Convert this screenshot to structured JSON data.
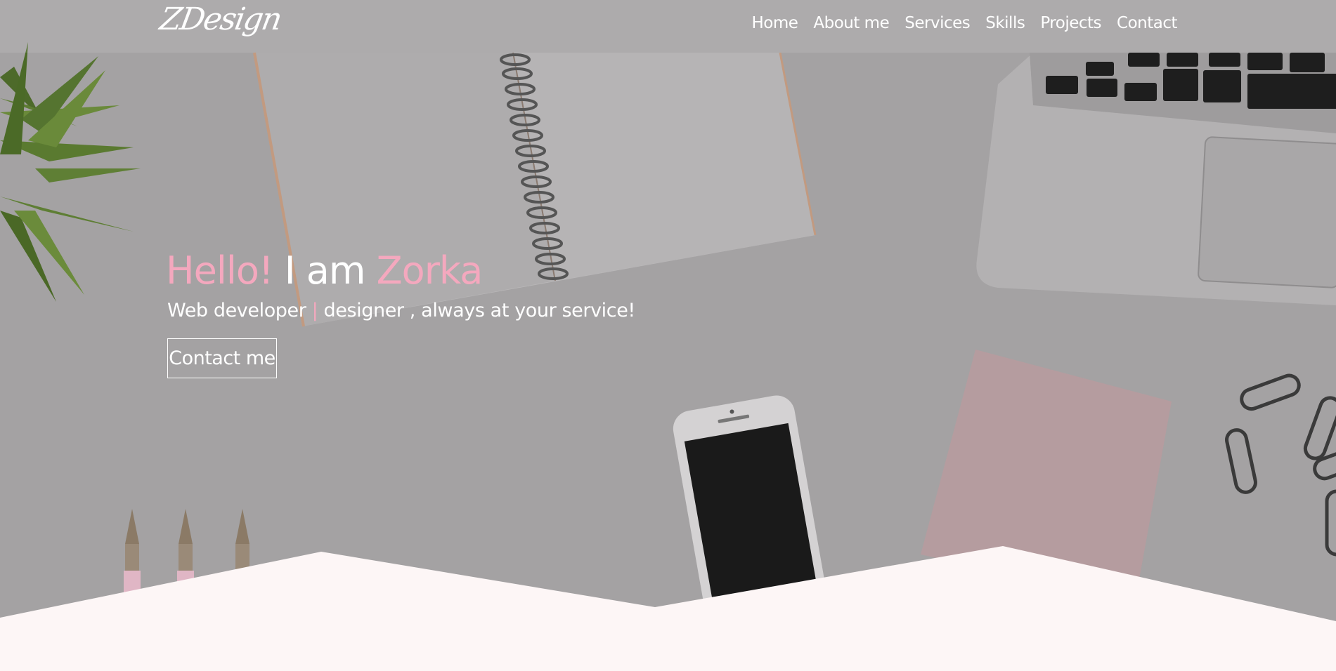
{
  "brand": {
    "logo_text": "ZDesign"
  },
  "nav": {
    "items": [
      {
        "label": "Home"
      },
      {
        "label": "About me"
      },
      {
        "label": "Services"
      },
      {
        "label": "Skills"
      },
      {
        "label": "Projects"
      },
      {
        "label": "Contact"
      }
    ]
  },
  "hero": {
    "greeting": "Hello!",
    "i_am": "I am",
    "name": "Zorka",
    "subtitle_part1": "Web developer",
    "subtitle_separator": "|",
    "subtitle_part2": "designer , always at your service!",
    "cta_label": "Contact me"
  },
  "colors": {
    "accent_pink": "#f4a8be",
    "overlay_gray": "#a4a2a3",
    "text_white": "#ffffff",
    "section_bg": "#fdf6f6"
  }
}
